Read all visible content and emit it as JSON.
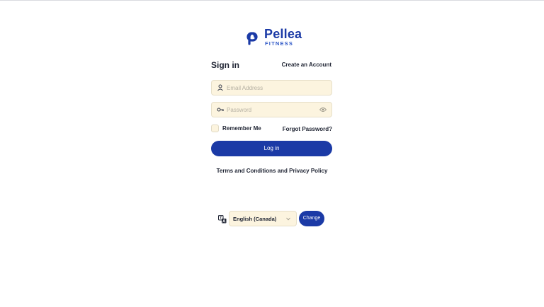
{
  "brand": {
    "name": "Pellea",
    "subtitle": "FITNESS",
    "color": "#1b3aa6"
  },
  "header": {
    "title": "Sign in",
    "create_account": "Create an Account"
  },
  "form": {
    "email": {
      "placeholder": "Email Address",
      "value": "",
      "icon": "user-icon"
    },
    "password": {
      "placeholder": "Password",
      "value": "",
      "icon": "key-icon",
      "toggle_icon": "eye-icon"
    },
    "remember_me": {
      "label": "Remember Me",
      "checked": false
    },
    "forgot_password": "Forgot Password?",
    "login_label": "Log in"
  },
  "footer": {
    "terms": "Terms and Conditions and Privacy Policy"
  },
  "language": {
    "icon": "translate-icon",
    "selected": "English (Canada)",
    "change_label": "Change"
  }
}
